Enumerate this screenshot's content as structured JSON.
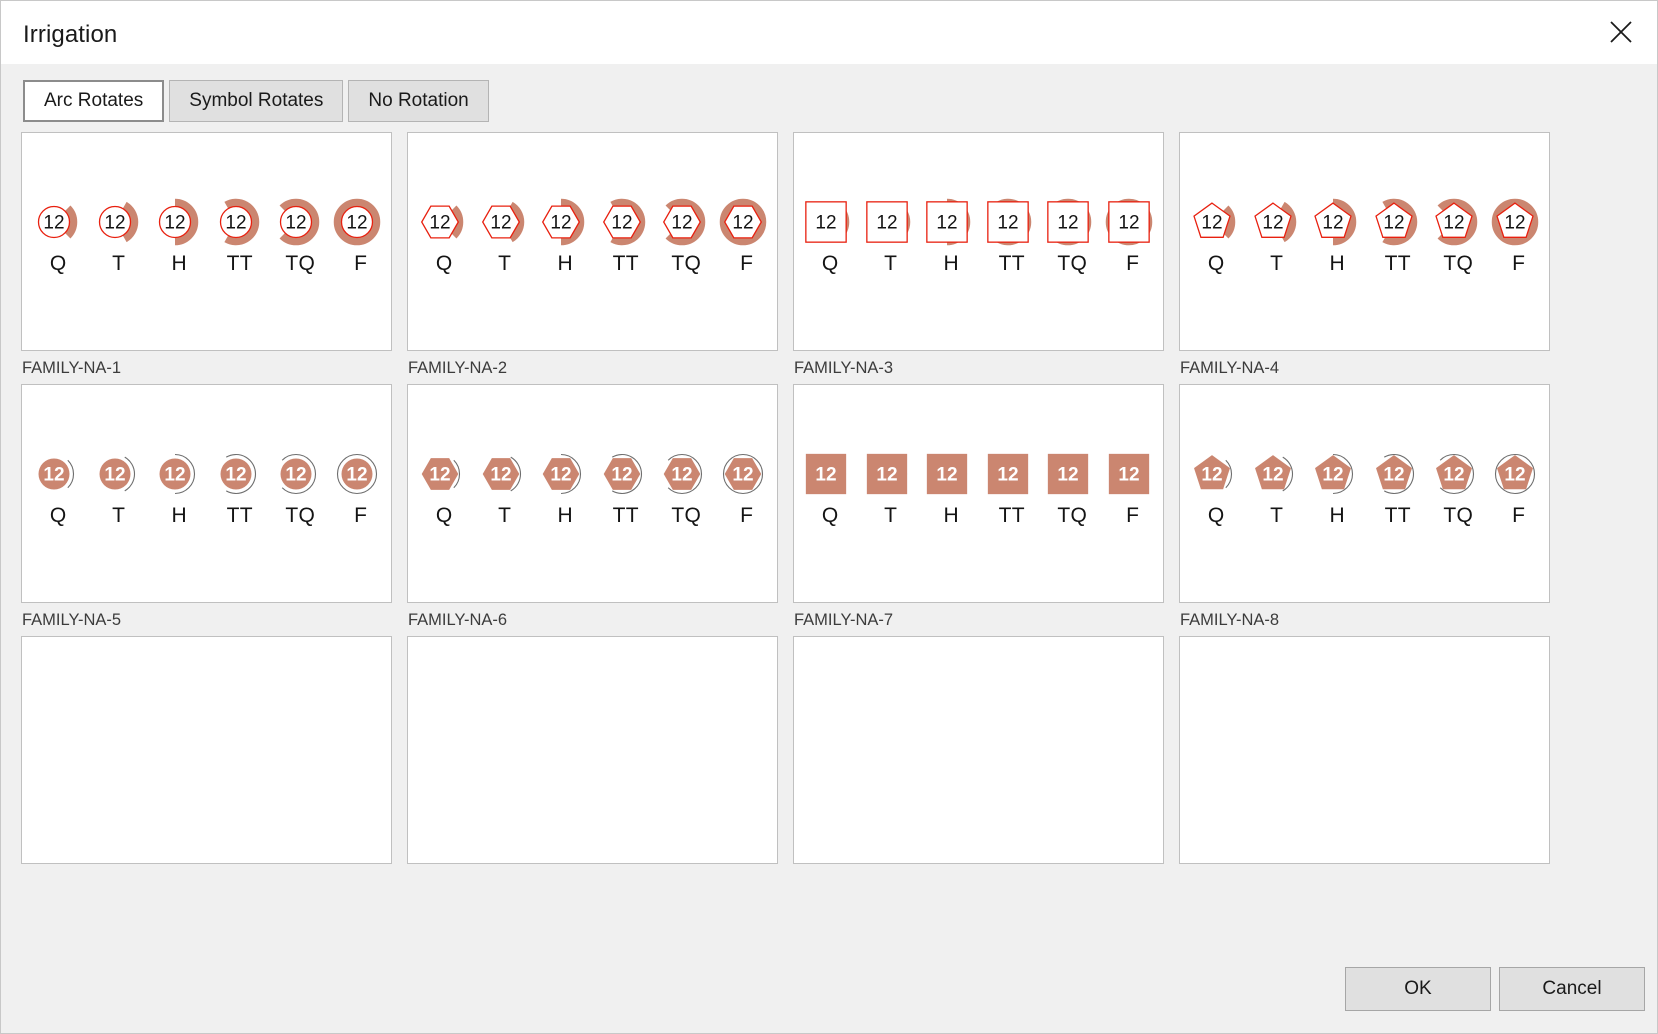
{
  "window": {
    "title": "Irrigation",
    "close_icon": "close-icon"
  },
  "tabs": [
    {
      "label": "Arc Rotates",
      "active": true
    },
    {
      "label": "Symbol Rotates",
      "active": false
    },
    {
      "label": "No Rotation",
      "active": false
    }
  ],
  "symbol_labels": [
    "Q",
    "T",
    "H",
    "TT",
    "TQ",
    "F"
  ],
  "symbol_arc_degrees": [
    90,
    120,
    180,
    240,
    270,
    360
  ],
  "symbol_text": "12",
  "colors": {
    "arc_fill": "#cb8670",
    "outline_red": "#e8200f",
    "solid_fill": "#cb8670",
    "arc_outline_gray": "#6e6e6e",
    "text_dark": "#141414",
    "text_white": "#ffffff",
    "panel_bg": "#ffffff",
    "dialog_bg": "#f0f0f0"
  },
  "families": [
    {
      "name": "FAMILY-NA-1",
      "shape": "circle",
      "style": "outline",
      "empty": false
    },
    {
      "name": "FAMILY-NA-2",
      "shape": "hexagon",
      "style": "outline",
      "empty": false
    },
    {
      "name": "FAMILY-NA-3",
      "shape": "square",
      "style": "outline",
      "empty": false
    },
    {
      "name": "FAMILY-NA-4",
      "shape": "pentagon",
      "style": "outline",
      "empty": false
    },
    {
      "name": "FAMILY-NA-5",
      "shape": "circle",
      "style": "solid",
      "empty": false
    },
    {
      "name": "FAMILY-NA-6",
      "shape": "hexagon",
      "style": "solid",
      "empty": false
    },
    {
      "name": "FAMILY-NA-7",
      "shape": "square",
      "style": "solid",
      "empty": false
    },
    {
      "name": "FAMILY-NA-8",
      "shape": "pentagon",
      "style": "solid",
      "empty": false
    },
    {
      "name": "",
      "shape": "",
      "style": "",
      "empty": true
    },
    {
      "name": "",
      "shape": "",
      "style": "",
      "empty": true
    },
    {
      "name": "",
      "shape": "",
      "style": "",
      "empty": true
    },
    {
      "name": "",
      "shape": "",
      "style": "",
      "empty": true
    }
  ],
  "footer": {
    "ok_label": "OK",
    "cancel_label": "Cancel"
  }
}
